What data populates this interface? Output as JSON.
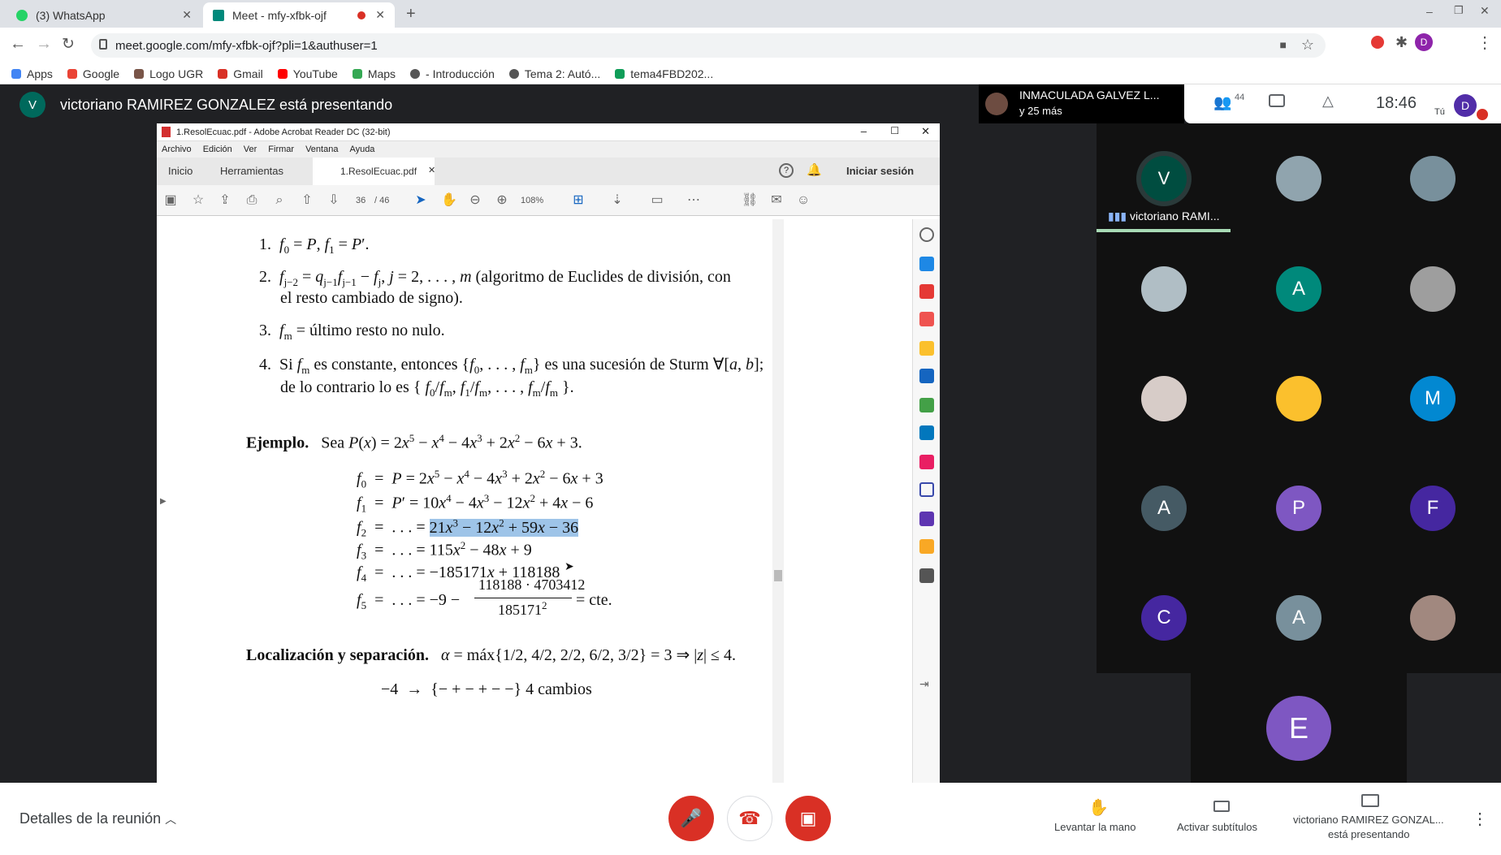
{
  "browser": {
    "tabs": [
      {
        "title": "(3) WhatsApp",
        "active": false
      },
      {
        "title": "Meet - mfy-xfbk-ojf",
        "active": true
      }
    ],
    "url": "meet.google.com/mfy-xfbk-ojf?pli=1&authuser=1",
    "bookmarks": [
      "Apps",
      "Google",
      "Logo UGR",
      "Gmail",
      "YouTube",
      "Maps",
      "- Introducción",
      "Tema 2: Autó...",
      "tema4FBD202..."
    ],
    "profile_initial": "D"
  },
  "meet": {
    "presenter_initial": "V",
    "presenter_text": "victoriano RAMIREZ GONZALEZ está presentando",
    "pinned_name": "INMACULADA GALVEZ L...",
    "pinned_more": "y 25 más",
    "participant_count": "44",
    "time": "18:46",
    "self_label": "Tú",
    "self_initial": "D",
    "speaking_name": "victoriano RAMI...",
    "tile_initials": [
      "V",
      "",
      "",
      "",
      "A",
      "",
      "",
      "",
      "M",
      "A",
      "P",
      "F",
      "C",
      "A",
      "",
      "E"
    ],
    "accent": "#8ab4f8",
    "details_label": "Detalles de la reunión",
    "raise_hand_label": "Levantar la mano",
    "captions_label": "Activar subtítulos",
    "presenting_label_1": "victoriano RAMIREZ GONZAL...",
    "presenting_label_2": "está presentando"
  },
  "acrobat": {
    "title": "1.ResolEcuac.pdf - Adobe Acrobat Reader DC (32-bit)",
    "menu": [
      "Archivo",
      "Edición",
      "Ver",
      "Firmar",
      "Ventana",
      "Ayuda"
    ],
    "tabs": [
      "Inicio",
      "Herramientas",
      "1.ResolEcuac.pdf"
    ],
    "signin": "Iniciar sesión",
    "page_current": "36",
    "page_total": "/ 46",
    "zoom": "108%"
  },
  "doc": {
    "items": [
      "1.",
      "2.",
      "3.",
      "4."
    ],
    "item2_tail": "(algoritmo de Euclides de división, con",
    "item2_line2": "el resto cambiado de signo).",
    "item3_text": "último resto no nulo.",
    "item4_text1": "es constante, entonces",
    "item4_text2": "es una sucesión de Sturm",
    "item4_line2": "de lo contrario lo es",
    "ejemplo": "Ejemplo.",
    "sea": "Sea",
    "loc": "Localización y separación.",
    "cambios": "4 cambios",
    "cte": "cte."
  }
}
